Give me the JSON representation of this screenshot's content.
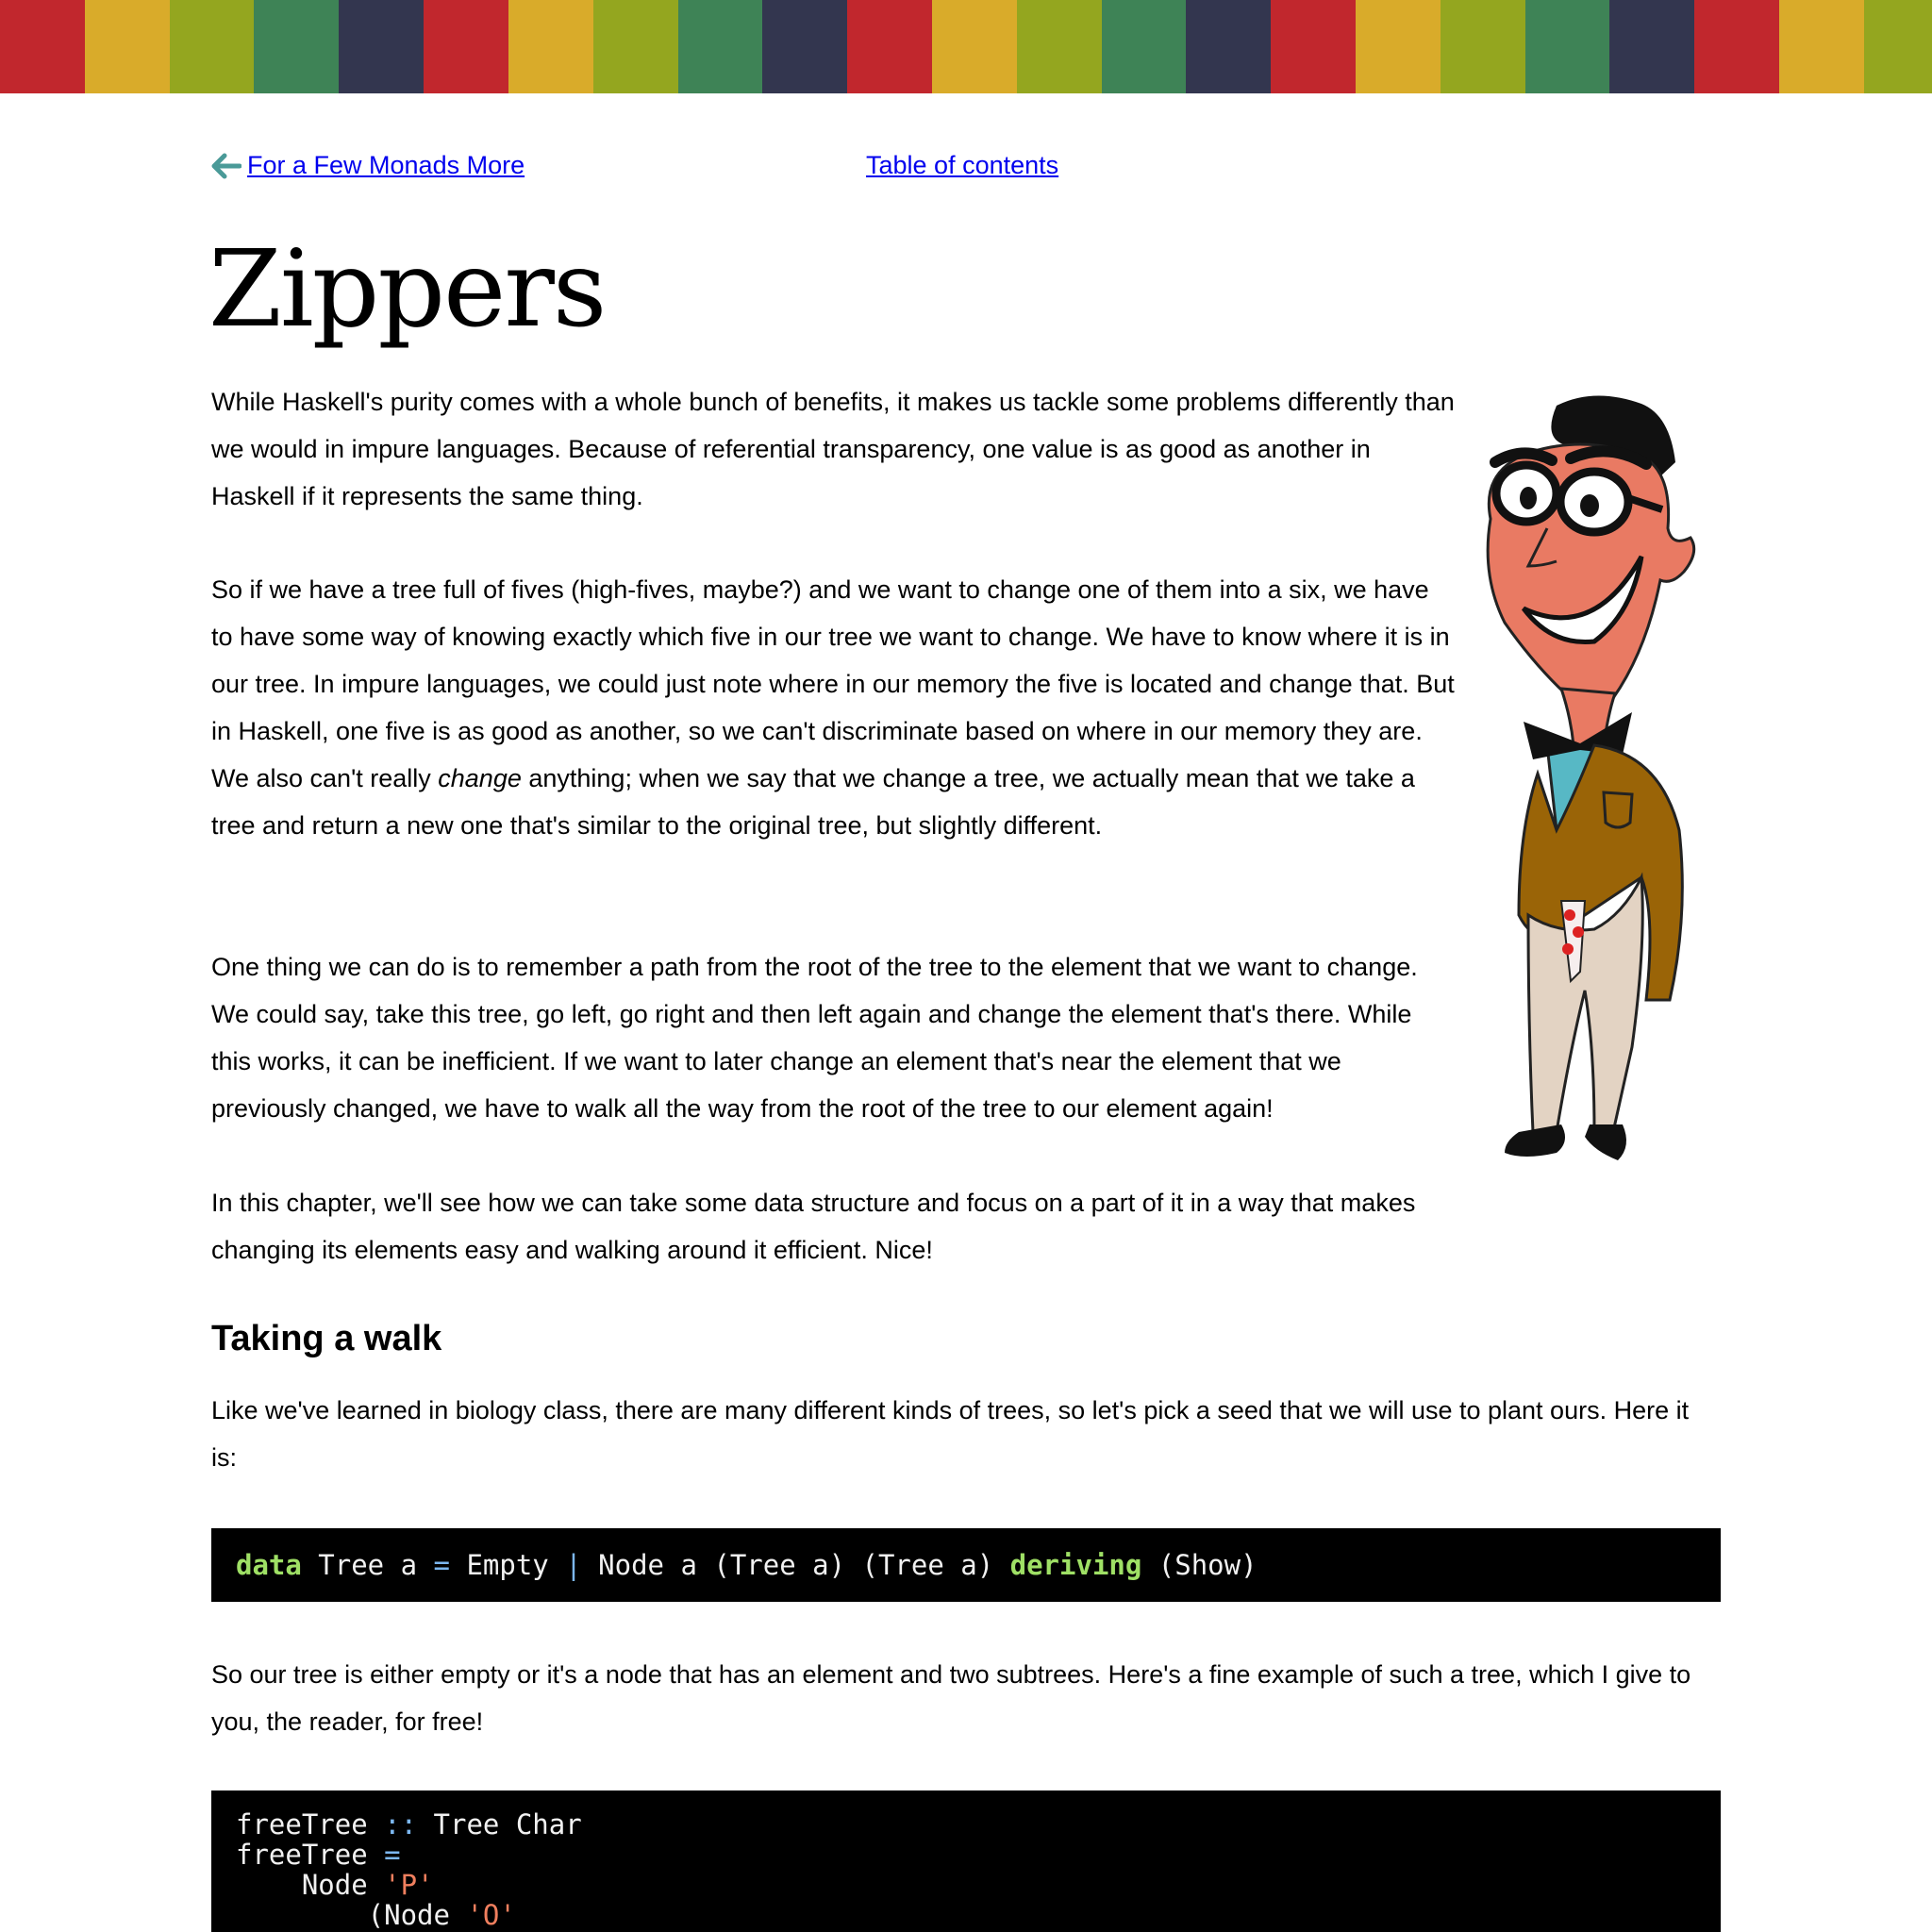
{
  "header": {
    "stripe_colors": [
      "#c1272d",
      "#d9ab2a",
      "#94a61f",
      "#3e8356",
      "#33364f",
      "#c1272d",
      "#d9ab2a",
      "#94a61f",
      "#3e8356",
      "#33364f",
      "#c1272d",
      "#d9ab2a",
      "#94a61f",
      "#3e8356",
      "#33364f",
      "#c1272d",
      "#d9ab2a",
      "#94a61f",
      "#3e8356",
      "#33364f",
      "#c1272d",
      "#d9ab2a",
      "#94a61f"
    ]
  },
  "nav": {
    "prev_label": "For a Few Monads More",
    "toc_label": "Table of contents"
  },
  "title": "Zippers",
  "intro": {
    "p1": "While Haskell's purity comes with a whole bunch of benefits, it makes us tackle some problems differently than we would in impure languages. Because of referential transparency, one value is as good as another in Haskell if it represents the same thing.",
    "p2_before": "So if we have a tree full of fives (high-fives, maybe?) and we want to change one of them into a six, we have to have some way of knowing exactly which five in our tree we want to change. We have to know where it is in our tree. In impure languages, we could just note where in our memory the five is located and change that. But in Haskell, one five is as good as another, so we can't discriminate based on where in our memory they are. We also can't really ",
    "p2_em": "change",
    "p2_after": " anything; when we say that we change a tree, we actually mean that we take a tree and return a new one that's similar to the original tree, but slightly different.",
    "p3": "One thing we can do is to remember a path from the root of the tree to the element that we want to change. We could say, take this tree, go left, go right and then left again and change the element that's there. While this works, it can be inefficient. If we want to later change an element that's near the element that we previously changed, we have to walk all the way from the root of the tree to our element again!",
    "p4": "In this chapter, we'll see how we can take some data structure and focus on a part of it in a way that makes changing its elements easy and walking around it efficient. Nice!"
  },
  "section": {
    "heading": "Taking a walk",
    "p1": "Like we've learned in biology class, there are many different kinds of trees, so let's pick a seed that we will use to plant ours. Here it is:",
    "code1": {
      "kw_data": "data",
      "t1": " Tree a ",
      "op_eq": "=",
      "t2": " Empty ",
      "op_bar": "|",
      "t3": " Node a (Tree a) (Tree a) ",
      "kw_deriving": "deriving",
      "t4": " (Show)"
    },
    "p2": "So our tree is either empty or it's a node that has an element and two subtrees. Here's a fine example of such a tree, which I give to you, the reader, for free!",
    "code2": {
      "l1_name": "freeTree ",
      "l1_op": "::",
      "l1_type": " Tree Char",
      "l2_name": "freeTree ",
      "l2_op": "=",
      "l3_indent": "    Node ",
      "l3_str": "'P'",
      "l4_indent": "        (Node ",
      "l4_str": "'O'"
    }
  },
  "illustration": {
    "icon": "man-with-glasses-illustration"
  }
}
